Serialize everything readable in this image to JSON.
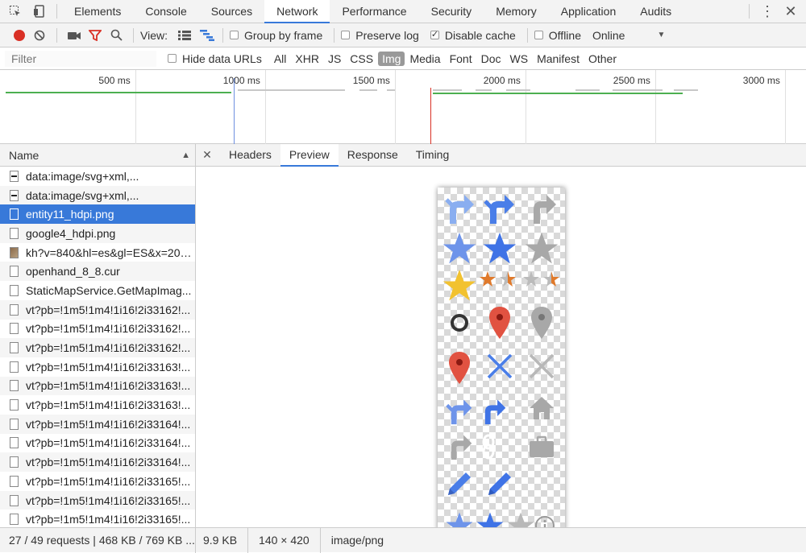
{
  "topbar": {
    "tabs": [
      "Elements",
      "Console",
      "Sources",
      "Network",
      "Performance",
      "Security",
      "Memory",
      "Application",
      "Audits"
    ],
    "active_tab": "Network"
  },
  "toolbar": {
    "view_label": "View:",
    "group_by_frame": "Group by frame",
    "preserve_log": "Preserve log",
    "disable_cache": "Disable cache",
    "offline": "Offline",
    "throttle": "Online"
  },
  "filterbar": {
    "placeholder": "Filter",
    "hide_data_urls": "Hide data URLs",
    "types": [
      "All",
      "XHR",
      "JS",
      "CSS",
      "Img",
      "Media",
      "Font",
      "Doc",
      "WS",
      "Manifest",
      "Other"
    ],
    "active_type": "Img"
  },
  "timeline": {
    "ticks": [
      "500 ms",
      "1000 ms",
      "1500 ms",
      "2000 ms",
      "2500 ms",
      "3000 ms"
    ]
  },
  "grid": {
    "header": "Name",
    "rows": [
      {
        "name": "data:image/svg+xml,...",
        "icon": "svg"
      },
      {
        "name": "data:image/svg+xml,...",
        "icon": "svg"
      },
      {
        "name": "entity11_hdpi.png",
        "icon": "file"
      },
      {
        "name": "google4_hdpi.png",
        "icon": "file"
      },
      {
        "name": "kh?v=840&hl=es&gl=ES&x=207...",
        "icon": "thumb"
      },
      {
        "name": "openhand_8_8.cur",
        "icon": "file"
      },
      {
        "name": "StaticMapService.GetMapImag...",
        "icon": "file"
      },
      {
        "name": "vt?pb=!1m5!1m4!1i16!2i33162!...",
        "icon": "file"
      },
      {
        "name": "vt?pb=!1m5!1m4!1i16!2i33162!...",
        "icon": "file"
      },
      {
        "name": "vt?pb=!1m5!1m4!1i16!2i33162!...",
        "icon": "file"
      },
      {
        "name": "vt?pb=!1m5!1m4!1i16!2i33163!...",
        "icon": "file"
      },
      {
        "name": "vt?pb=!1m5!1m4!1i16!2i33163!...",
        "icon": "file"
      },
      {
        "name": "vt?pb=!1m5!1m4!1i16!2i33163!...",
        "icon": "file"
      },
      {
        "name": "vt?pb=!1m5!1m4!1i16!2i33164!...",
        "icon": "file"
      },
      {
        "name": "vt?pb=!1m5!1m4!1i16!2i33164!...",
        "icon": "file"
      },
      {
        "name": "vt?pb=!1m5!1m4!1i16!2i33164!...",
        "icon": "file"
      },
      {
        "name": "vt?pb=!1m5!1m4!1i16!2i33165!...",
        "icon": "file"
      },
      {
        "name": "vt?pb=!1m5!1m4!1i16!2i33165!...",
        "icon": "file"
      },
      {
        "name": "vt?pb=!1m5!1m4!1i16!2i33165!...",
        "icon": "file"
      }
    ],
    "selected_index": 2
  },
  "detail": {
    "tabs": [
      "Headers",
      "Preview",
      "Response",
      "Timing"
    ],
    "active_tab": "Preview"
  },
  "status": {
    "requests": "27 / 49 requests | 468 KB / 769 KB ...",
    "size": "9.9 KB",
    "dimensions": "140 × 420",
    "mime": "image/png"
  },
  "colors": {
    "accent": "#3879d9",
    "record": "#d93025",
    "blue_icon": "#4a7ee8",
    "gray_icon": "#a8a8a8",
    "red_pin": "#e15241",
    "gold_star": "#f2c230",
    "orange_star": "#e07a2b"
  }
}
